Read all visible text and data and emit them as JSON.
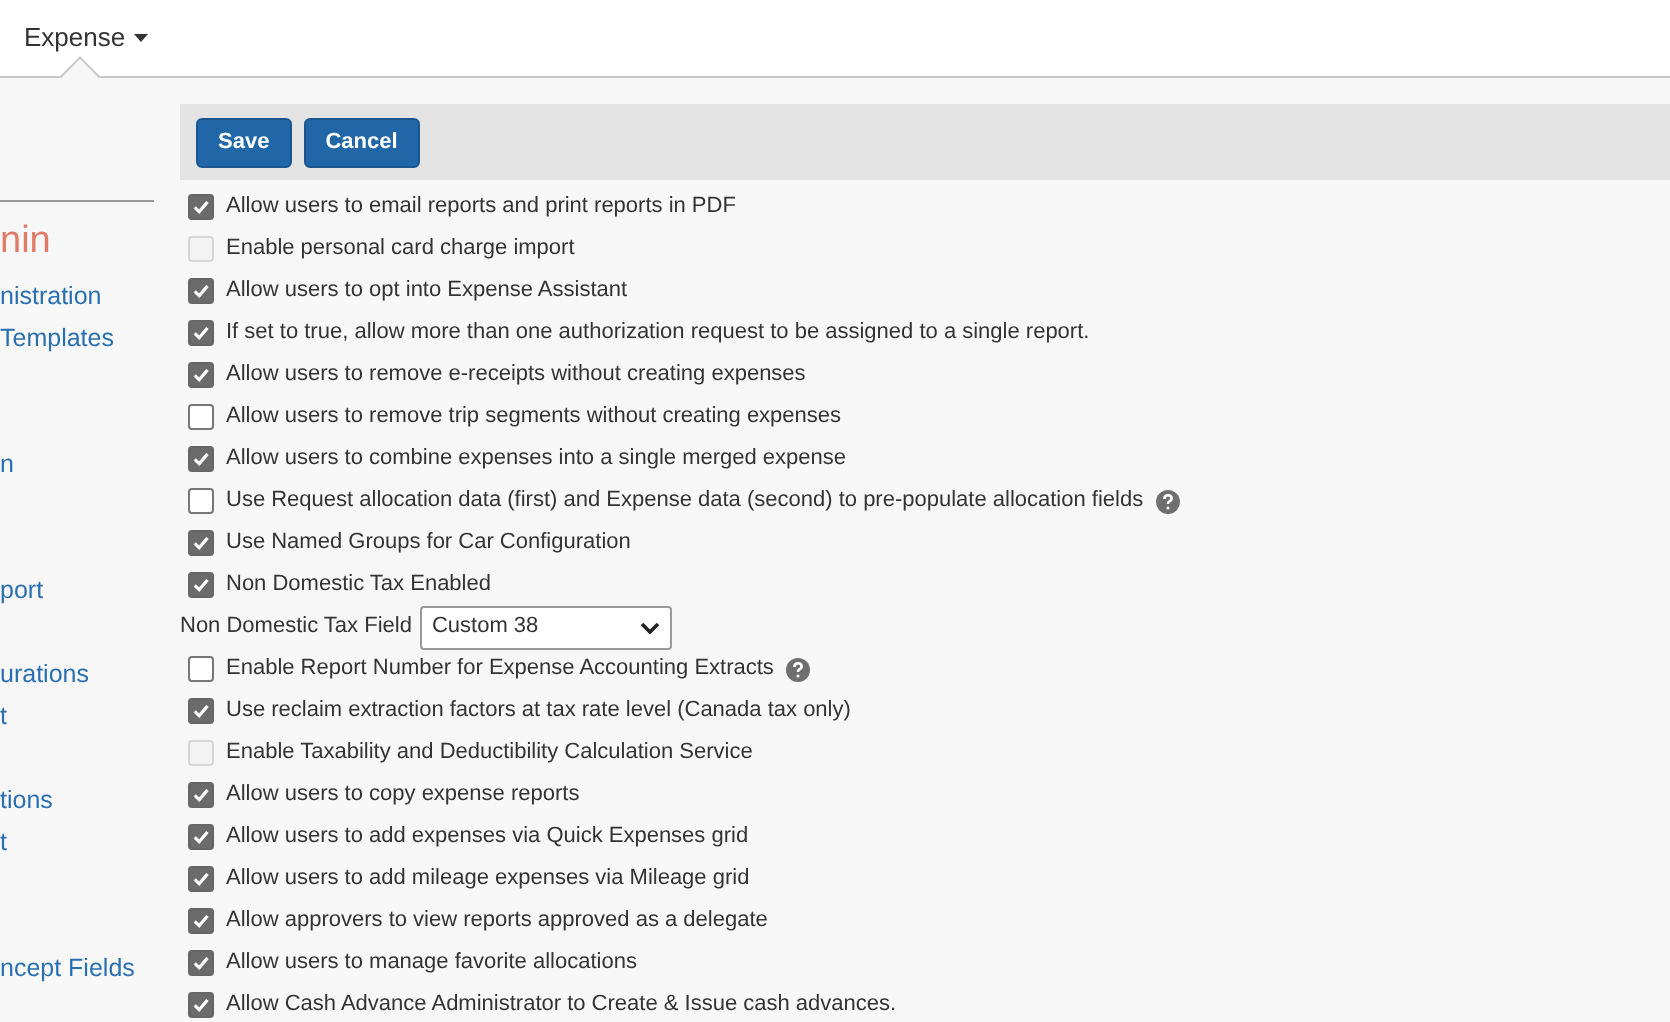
{
  "top_menu": {
    "label": "Expense"
  },
  "sidebar": {
    "heading": "nin",
    "items": [
      {
        "label": "nistration"
      },
      {
        "label": "Templates"
      },
      {
        "label": "n"
      },
      {
        "label": "port"
      },
      {
        "label": "urations"
      },
      {
        "label": "t"
      },
      {
        "label": "tions"
      },
      {
        "label": "t"
      },
      {
        "label": "ncept Fields"
      }
    ]
  },
  "toolbar": {
    "buttons": [
      "Save",
      "Cancel"
    ]
  },
  "settings": [
    {
      "kind": "checkbox",
      "label": "Allow users to email reports and print reports in PDF",
      "checked": true,
      "disabled": false,
      "help": false
    },
    {
      "kind": "checkbox",
      "label": "Enable personal card charge import",
      "checked": false,
      "disabled": true,
      "help": false
    },
    {
      "kind": "checkbox",
      "label": "Allow users to opt into Expense Assistant",
      "checked": true,
      "disabled": false,
      "help": false
    },
    {
      "kind": "checkbox",
      "label": "If set to true, allow more than one authorization request to be assigned to a single report.",
      "checked": true,
      "disabled": false,
      "help": false
    },
    {
      "kind": "checkbox",
      "label": "Allow users to remove e-receipts without creating expenses",
      "checked": true,
      "disabled": false,
      "help": false
    },
    {
      "kind": "checkbox",
      "label": "Allow users to remove trip segments without creating expenses",
      "checked": false,
      "disabled": false,
      "help": false
    },
    {
      "kind": "checkbox",
      "label": "Allow users to combine expenses into a single merged expense",
      "checked": true,
      "disabled": false,
      "help": false
    },
    {
      "kind": "checkbox",
      "label": "Use Request allocation data (first) and Expense data (second) to pre-populate allocation fields",
      "checked": false,
      "disabled": false,
      "help": true
    },
    {
      "kind": "checkbox",
      "label": "Use Named Groups for Car Configuration",
      "checked": true,
      "disabled": false,
      "help": false
    },
    {
      "kind": "checkbox",
      "label": "Non Domestic Tax Enabled",
      "checked": true,
      "disabled": false,
      "help": false
    },
    {
      "kind": "select",
      "label": "Non Domestic Tax Field",
      "value": "Custom 38"
    },
    {
      "kind": "checkbox",
      "label": "Enable Report Number for Expense Accounting Extracts",
      "checked": false,
      "disabled": false,
      "help": true
    },
    {
      "kind": "checkbox",
      "label": "Use reclaim extraction factors at tax rate level (Canada tax only)",
      "checked": true,
      "disabled": false,
      "help": false
    },
    {
      "kind": "checkbox",
      "label": "Enable Taxability and Deductibility Calculation Service",
      "checked": false,
      "disabled": true,
      "help": false
    },
    {
      "kind": "checkbox",
      "label": "Allow users to copy expense reports",
      "checked": true,
      "disabled": false,
      "help": false
    },
    {
      "kind": "checkbox",
      "label": "Allow users to add expenses via Quick Expenses grid",
      "checked": true,
      "disabled": false,
      "help": false
    },
    {
      "kind": "checkbox",
      "label": "Allow users to add mileage expenses via Mileage grid",
      "checked": true,
      "disabled": false,
      "help": false
    },
    {
      "kind": "checkbox",
      "label": "Allow approvers to view reports approved as a delegate",
      "checked": true,
      "disabled": false,
      "help": false
    },
    {
      "kind": "checkbox",
      "label": "Allow users to manage favorite allocations",
      "checked": true,
      "disabled": false,
      "help": false
    },
    {
      "kind": "checkbox",
      "label": "Allow Cash Advance Administrator to Create & Issue cash advances.",
      "checked": true,
      "disabled": false,
      "help": false
    }
  ]
}
